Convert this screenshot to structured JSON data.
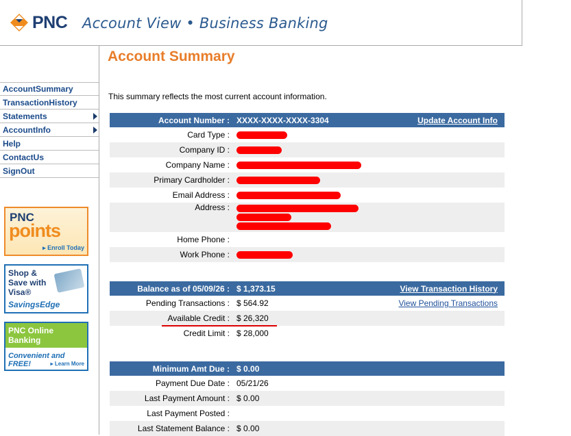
{
  "header": {
    "logo_text": "PNC",
    "title": "Account View • Business Banking"
  },
  "nav": [
    {
      "label": "AccountSummary"
    },
    {
      "label": "TransactionHistory"
    },
    {
      "label": "Statements"
    },
    {
      "label": "AccountInfo"
    },
    {
      "label": "Help"
    },
    {
      "label": "ContactUs"
    },
    {
      "label": "SignOut"
    }
  ],
  "promos": {
    "points": {
      "brand": "PNC",
      "name": "points",
      "cta": "▸ Enroll Today"
    },
    "savings": {
      "line1": "Shop &",
      "line2": "Save with",
      "line3": "Visa®",
      "name": "SavingsEdge"
    },
    "online": {
      "line1": "PNC Online",
      "line2": "Banking",
      "tagline": "Convenient and FREE!",
      "cta": "▸ Learn More"
    }
  },
  "main": {
    "title": "Account Summary",
    "intro": "This summary reflects the most current account information."
  },
  "account": {
    "number_label": "Account Number :",
    "number_value": "XXXX-XXXX-XXXX-3304",
    "update_link": "Update Account Info",
    "card_type_label": "Card Type :",
    "company_id_label": "Company ID :",
    "company_name_label": "Company Name :",
    "primary_label": "Primary Cardholder :",
    "email_label": "Email Address :",
    "address_label": "Address :",
    "home_phone_label": "Home Phone :",
    "work_phone_label": "Work Phone :"
  },
  "balance": {
    "label": "Balance as of 05/09/26 :",
    "value": "$ 1,373.15",
    "history_link": "View Transaction History",
    "pending_label": "Pending Transactions :",
    "pending_value": "$ 564.92",
    "pending_link": "View Pending Transactions",
    "available_label": "Available Credit :",
    "available_value": "$ 26,320",
    "limit_label": "Credit Limit :",
    "limit_value": "$ 28,000"
  },
  "payment": {
    "min_label": "Minimum Amt Due :",
    "min_value": "$ 0.00",
    "due_date_label": "Payment Due Date :",
    "due_date_value": "05/21/26",
    "last_amt_label": "Last Payment Amount :",
    "last_amt_value": "$ 0.00",
    "last_posted_label": "Last Payment Posted :",
    "last_posted_value": "",
    "last_stmt_label": "Last Statement Balance :",
    "last_stmt_value": "$ 0.00"
  },
  "colors": {
    "header_blue": "#3b6aa0",
    "brand_orange": "#e87d2a",
    "redaction": "#ff0000"
  }
}
